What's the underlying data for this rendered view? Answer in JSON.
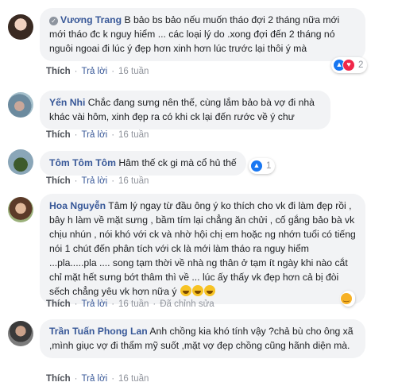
{
  "comments": [
    {
      "author": "Vương Trang",
      "verified_mark": "✓",
      "text": "B bảo bs bảo nếu muốn tháo đợi 2 tháng nữa mới mới tháo đc k nguy hiểm ... các loại lý do .xong đợi đến 2 tháng nó nguôi ngoai đi lúc ý đẹp hơn xinh hơn lúc trước lại thôi ý mà",
      "reactions_count": "2",
      "reaction_icons": [
        "like-icon",
        "love-icon"
      ],
      "actions": {
        "like": "Thích",
        "reply": "Trả lời",
        "time": "16 tuần"
      }
    },
    {
      "author": "Yến Nhi",
      "text": "Chắc đang sưng nên thế, cùng lắm bảo bà vợ đi nhà khác vài hôm, xinh đẹp ra có khi ck lại đến rước về ý chư",
      "actions": {
        "like": "Thích",
        "reply": "Trả lời",
        "time": "16 tuần"
      }
    },
    {
      "author": "Tôm Tôm Tôm",
      "text": "Hâm thế ck gi mà cổ hủ thế",
      "reactions_count": "1",
      "reaction_icons": [
        "like-icon"
      ],
      "actions": {
        "like": "Thích",
        "reply": "Trả lời",
        "time": "16 tuần"
      }
    },
    {
      "author": "Hoa Nguyễn",
      "text": "Tâm lý ngay từ đầu ông ý ko thích cho vk đi làm đẹp rồi , bây h làm về mặt sưng , bầm tím lại chẳng ăn chửi , cố gắng bảo bà vk chịu nhún , nói khó với ck và nhờ hội chị em hoặc ng nhớn tuổi có tiếng nói 1 chút đến phân tích với ck là mới làm tháo ra nguy hiểm ...pla.....pla .... song tạm thời về nhà ng thân ở tạm ít ngày khi nào cắt chỉ mặt hết sưng bớt thâm thì về ... lúc ấy thấy vk đẹp hơn cả bị đòi sếch chẳng yêu vk hơn nữa ý",
      "reaction_icons": [
        "haha-icon"
      ],
      "actions": {
        "like": "Thích",
        "reply": "Trả lời",
        "time": "16 tuần",
        "edited": "Đã chỉnh sửa"
      }
    },
    {
      "author": "Trần Tuấn Phong Lan",
      "text": "Anh chồng kia khó tính vậy ?chả bù cho ông xã ,mình giục vợ đi thẩm mỹ suốt ,mặt vợ đẹp chồng cũng hãnh diện mà.",
      "actions": {
        "like": "Thích",
        "reply": "Trả lời",
        "time": "16 tuần"
      }
    }
  ],
  "colors": {
    "author": "#385898",
    "bubble": "#f2f3f5",
    "like": "#1877f2",
    "love": "#f0284a",
    "haha": "#f7b125"
  }
}
